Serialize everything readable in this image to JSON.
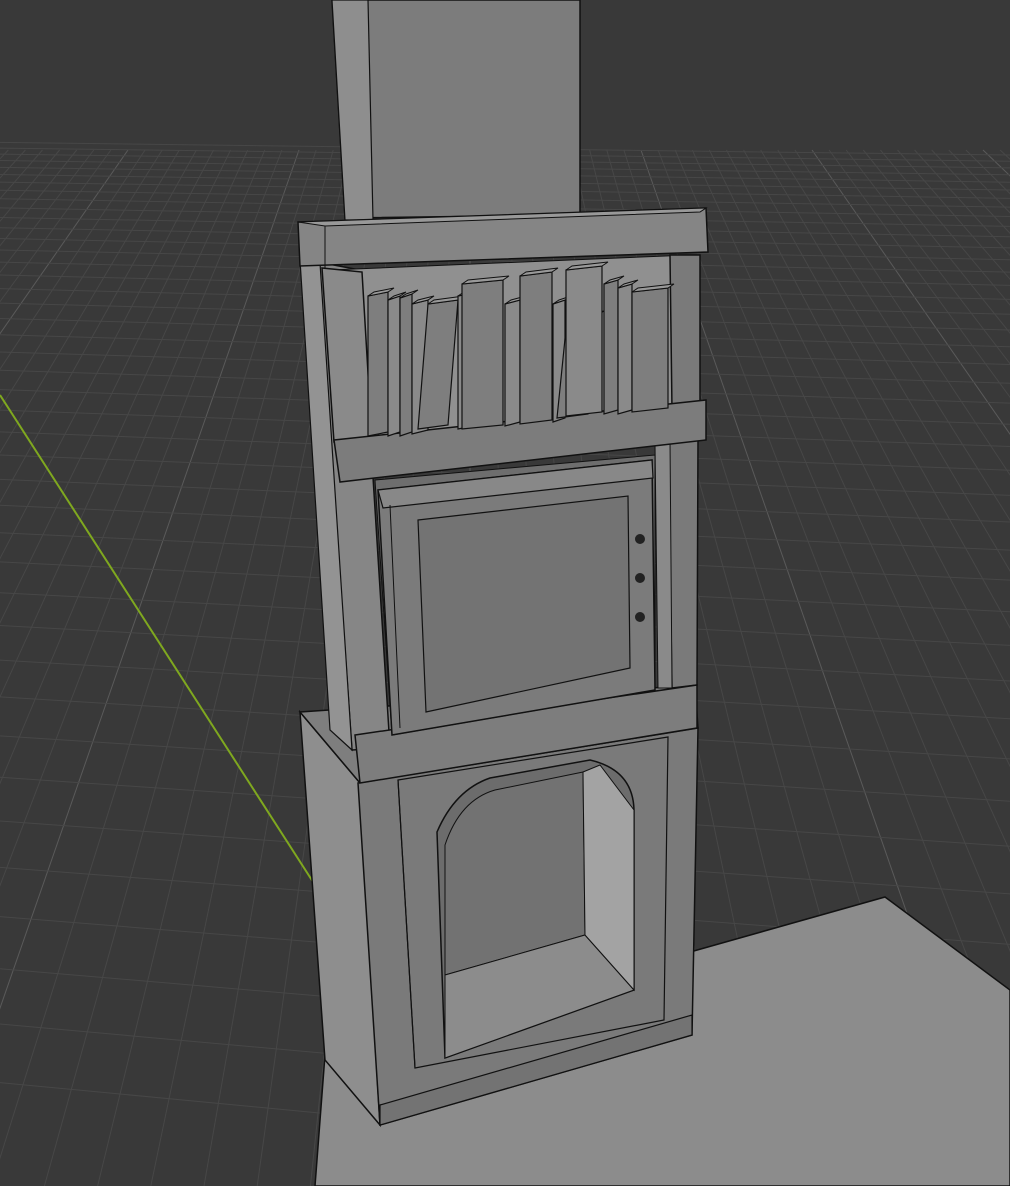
{
  "viewport": {
    "mode": "solid-shading-wireframe",
    "colors": {
      "background": "#393939",
      "grid_minor": "#474747",
      "grid_major": "#5a5a5a",
      "axis_y": "#7fa81f",
      "floor": "#8c8c8c",
      "outline": "#111111",
      "face_light": "#8a8a8a",
      "face_mid": "#7a7a7a",
      "face_dark": "#666666",
      "face_inner": "#717171"
    }
  },
  "scene": {
    "objects": [
      {
        "id": "pillar",
        "label": ""
      },
      {
        "id": "bookshelf-top",
        "label": ""
      },
      {
        "id": "books",
        "label": ""
      },
      {
        "id": "cabinet-door",
        "label": ""
      },
      {
        "id": "base-cabinet",
        "label": ""
      }
    ]
  }
}
